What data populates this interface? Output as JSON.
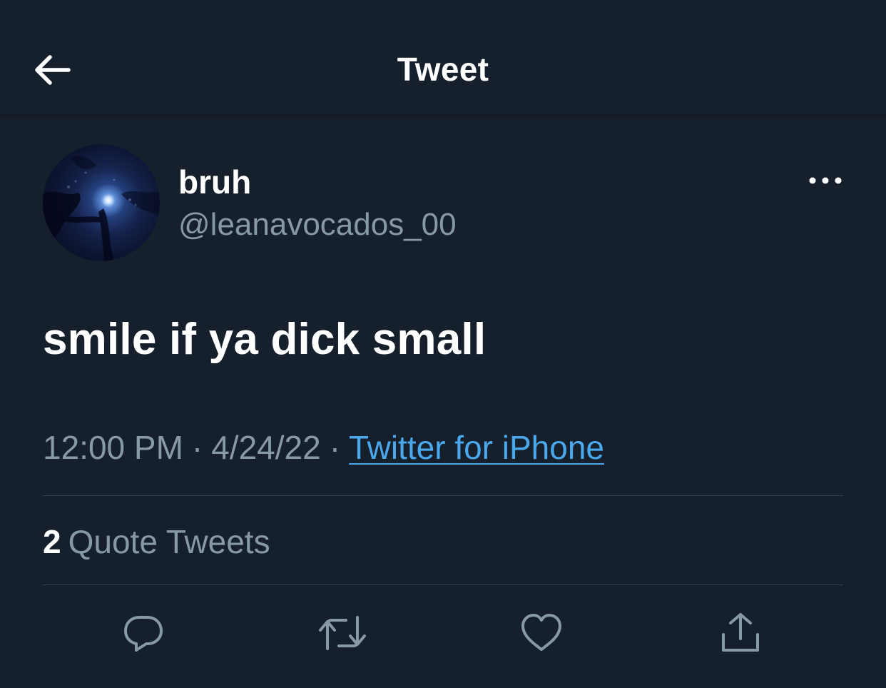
{
  "header": {
    "title": "Tweet",
    "back_icon": "arrow-left-icon"
  },
  "author": {
    "display_name": "bruh",
    "username": "@leanavocados_00",
    "avatar": "moonlit-tree-night-photo"
  },
  "tweet": {
    "text": "smile if ya dick small",
    "time": "12:00 PM",
    "separator": "·",
    "date": "4/24/22",
    "source": "Twitter for iPhone"
  },
  "stats": {
    "quote_count": "2",
    "quote_label": "Quote Tweets"
  },
  "actions": {
    "reply_icon": "reply-icon",
    "retweet_icon": "retweet-icon",
    "like_icon": "heart-icon",
    "share_icon": "share-icon"
  },
  "colors": {
    "background": "#16202c",
    "secondary_text": "#8899a6",
    "link": "#4aa8ec",
    "divider": "#38444d"
  }
}
